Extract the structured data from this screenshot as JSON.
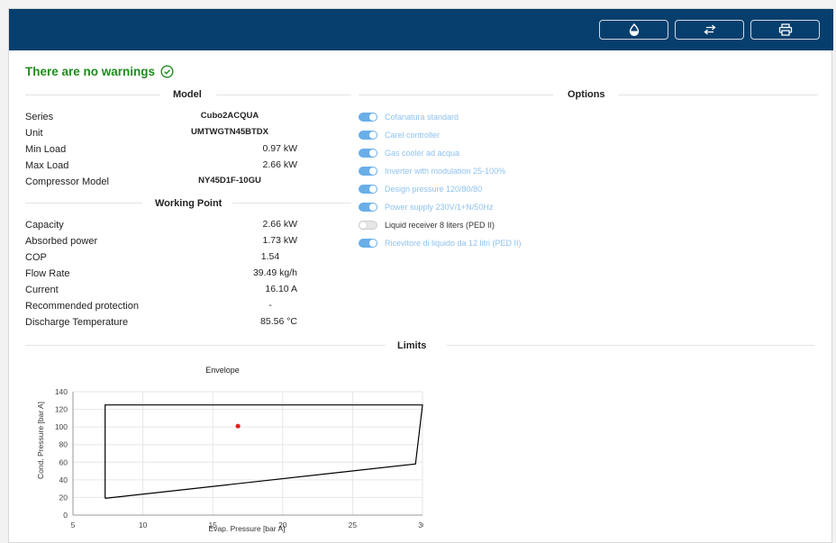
{
  "toolbar": {
    "buttons": [
      {
        "name": "drop-button",
        "icon": "drop-icon"
      },
      {
        "name": "swap-button",
        "icon": "swap-arrows-icon"
      },
      {
        "name": "print-button",
        "icon": "printer-icon"
      }
    ]
  },
  "status": {
    "warning_text": "There are no warnings",
    "icon": "check-circle-icon",
    "color": "#1f8c1f"
  },
  "model": {
    "heading": "Model",
    "rows": [
      {
        "label": "Series",
        "value": "Cubo2ACQUA"
      },
      {
        "label": "Unit",
        "value": "UMTWGTN45BTDX"
      },
      {
        "label": "Min Load",
        "value": "0.97 kW"
      },
      {
        "label": "Max Load",
        "value": "2.66 kW"
      },
      {
        "label": "Compressor Model",
        "value": "NY45D1F-10GU"
      }
    ]
  },
  "working_point": {
    "heading": "Working Point",
    "rows": [
      {
        "label": "Capacity",
        "value": "2.66 kW"
      },
      {
        "label": "Absorbed power",
        "value": "1.73 kW"
      },
      {
        "label": "COP",
        "value": "1.54"
      },
      {
        "label": "Flow Rate",
        "value": "39.49 kg/h"
      },
      {
        "label": "Current",
        "value": "16.10 A"
      },
      {
        "label": "Recommended protection",
        "value": "-"
      },
      {
        "label": "Discharge Temperature",
        "value": "85.56 °C"
      }
    ]
  },
  "options": {
    "heading": "Options",
    "items": [
      {
        "label": "Cofanatura standard",
        "enabled": true
      },
      {
        "label": "Carel controller",
        "enabled": true
      },
      {
        "label": "Gas cooler ad acqua",
        "enabled": true
      },
      {
        "label": "Inverter with modulation 25-100%",
        "enabled": true
      },
      {
        "label": "Design pressure 120/80/80",
        "enabled": true
      },
      {
        "label": "Power supply 230V/1+N/50Hz",
        "enabled": true
      },
      {
        "label": "Liquid receiver 8 liters (PED II)",
        "enabled": false
      },
      {
        "label": "Ricevitore di liquido da 12 litri (PED II)",
        "enabled": true
      }
    ]
  },
  "limits": {
    "heading": "Limits"
  },
  "chart_data": {
    "type": "scatter",
    "title": "Envelope",
    "xlabel": "Evap. Pressure [bar A]",
    "ylabel": "Cond. Pressure [bar A]",
    "xlim": [
      5,
      30
    ],
    "ylim": [
      0,
      140
    ],
    "x_ticks": [
      5,
      10,
      15,
      20,
      25,
      30
    ],
    "y_ticks": [
      0,
      20,
      40,
      60,
      80,
      100,
      120,
      140
    ],
    "grid": true,
    "envelope": [
      {
        "x": 7.3,
        "y": 19
      },
      {
        "x": 7.3,
        "y": 125
      },
      {
        "x": 30,
        "y": 125
      },
      {
        "x": 29.5,
        "y": 58
      },
      {
        "x": 7.3,
        "y": 19
      }
    ],
    "points": [
      {
        "x": 16.8,
        "y": 101
      }
    ],
    "colors": {
      "envelope": "#000000",
      "point": "#e8201c",
      "grid": "#e6e6e6"
    }
  }
}
